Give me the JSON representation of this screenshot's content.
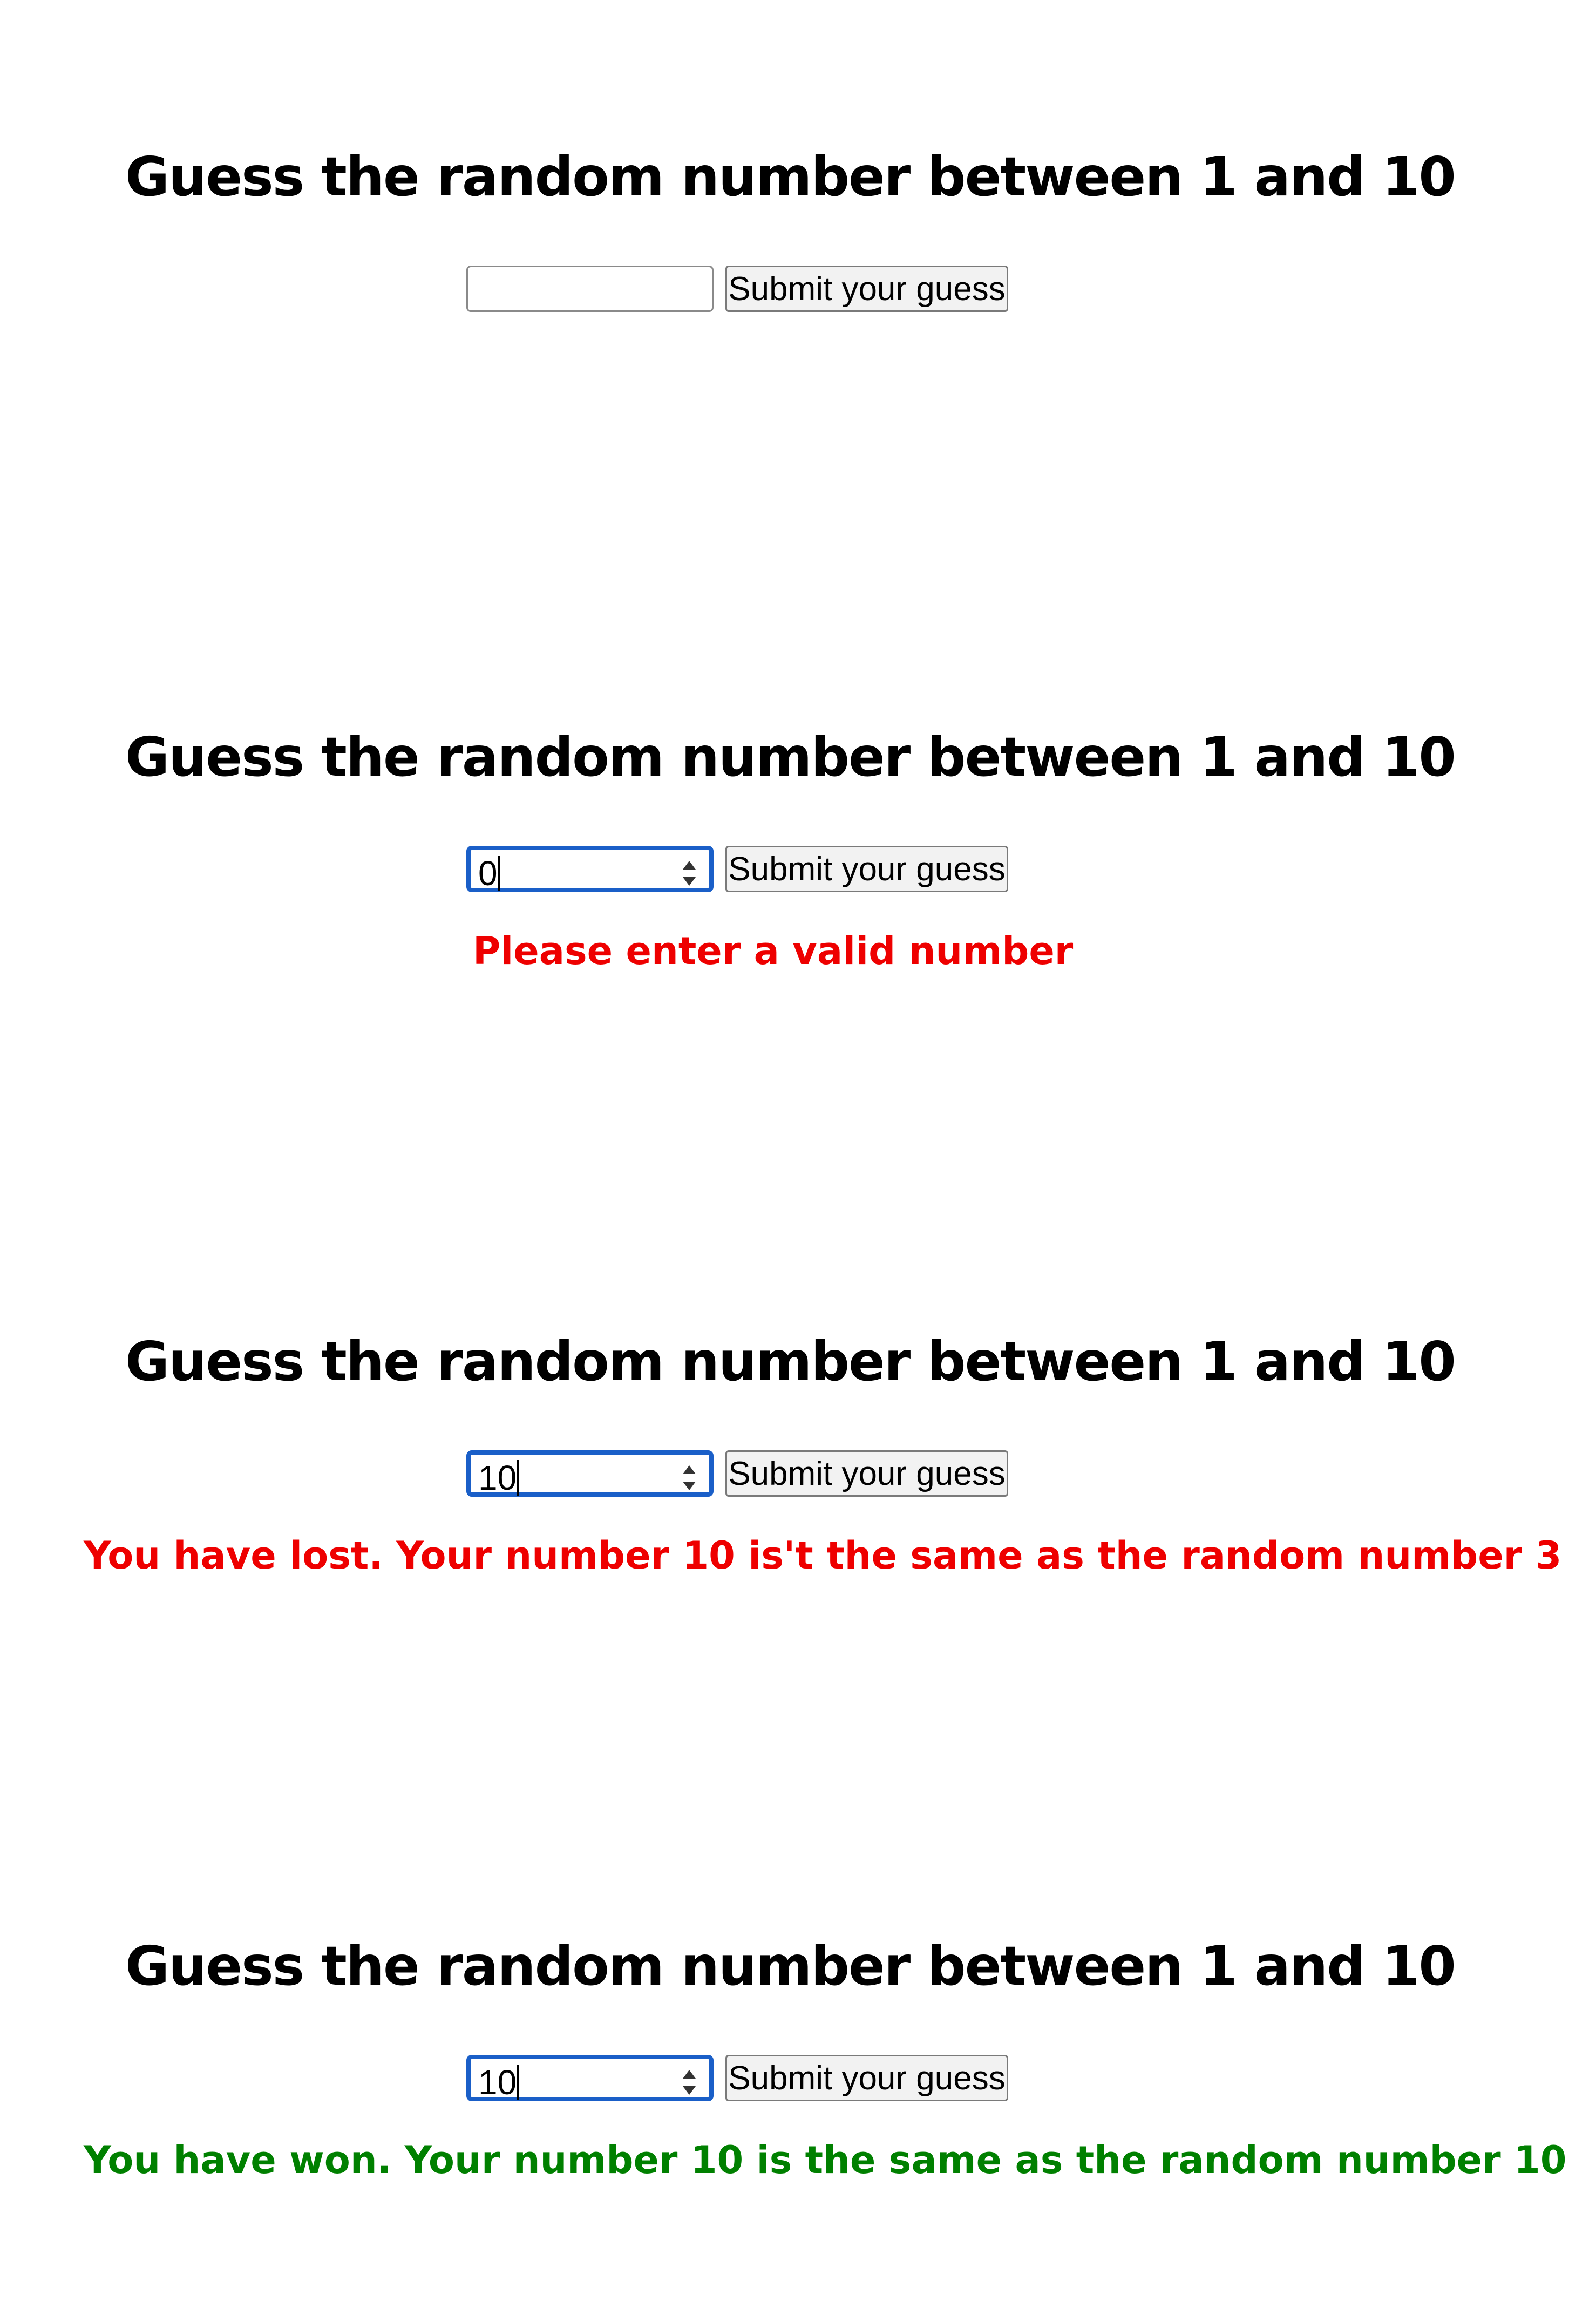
{
  "colors": {
    "error": "#ee0000",
    "success": "#008000",
    "focus_ring": "#1a5fc8"
  },
  "panels": [
    {
      "title": "Guess the random number between 1 and 10",
      "input_value": "",
      "button_label": "Submit your guess",
      "message": ""
    },
    {
      "title": "Guess the random number between 1 and 10",
      "input_value": "0",
      "button_label": "Submit your guess",
      "message": "Please enter a valid number"
    },
    {
      "title": "Guess the random number between 1 and 10",
      "input_value": "10",
      "button_label": "Submit your guess",
      "message": "You have lost. Your number 10 is't the same as the random number 3"
    },
    {
      "title": "Guess the random number between 1 and 10",
      "input_value": "10",
      "button_label": "Submit your guess",
      "message": "You have won. Your number 10 is the same as the random number 10"
    }
  ]
}
